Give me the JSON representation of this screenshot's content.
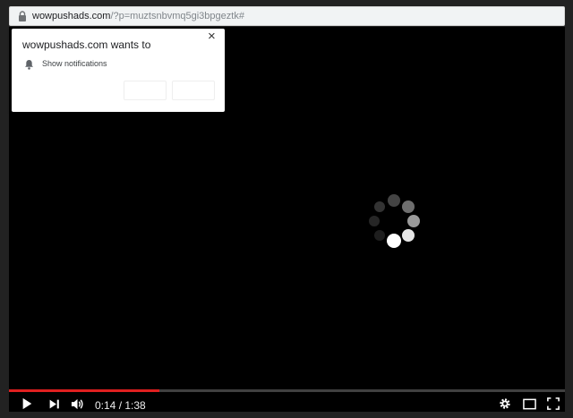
{
  "browser": {
    "url_host": "wowpushads.com",
    "url_path": "/?p=muztsnbvmq5gi3bpgeztk#",
    "lock_icon": "lock-icon"
  },
  "permission_prompt": {
    "title": "wowpushads.com wants to",
    "permission_label": "Show notifications",
    "permission_icon": "bell-icon",
    "close_icon": "close-icon"
  },
  "player": {
    "time_display": "0:14 / 1:38",
    "progress_fraction": 0.27,
    "progress_color": "#e02020",
    "loading_icon": "loading-spinner-icon",
    "controls": [
      "play-icon",
      "next-icon",
      "volume-icon",
      "settings-icon",
      "miniplayer-icon",
      "fullscreen-icon"
    ]
  }
}
